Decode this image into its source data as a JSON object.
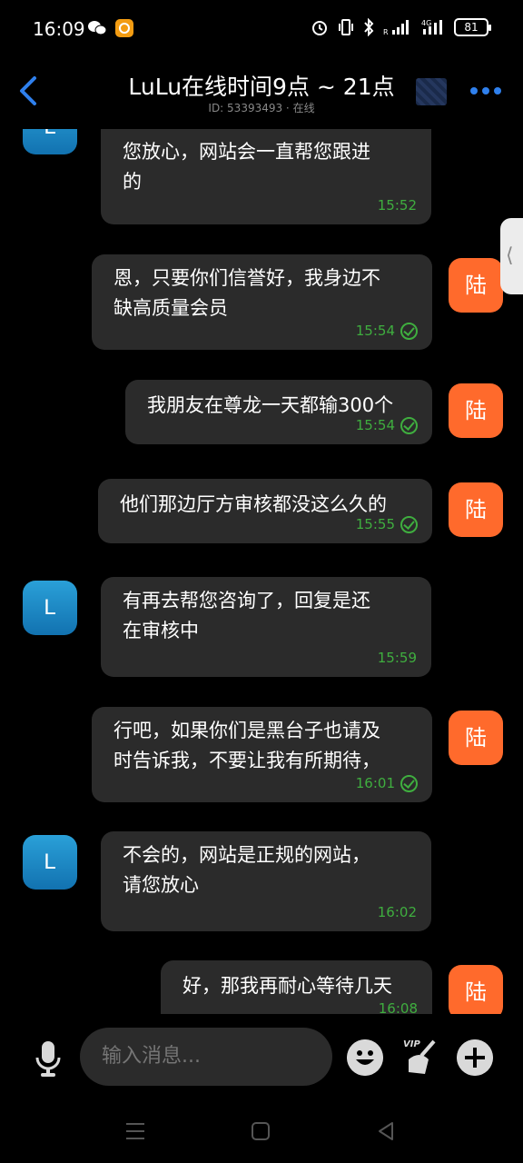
{
  "status_bar": {
    "time": "16:09",
    "battery": "81",
    "icons": [
      "wechat-icon",
      "app-badge-icon",
      "alarm-icon",
      "vibrate-icon",
      "bluetooth-icon",
      "signal-icon",
      "4g-signal-icon",
      "battery-icon"
    ]
  },
  "header": {
    "title": "LuLu在线时间9点 ~ 21点",
    "subtitle": "ID: 53393493 · 在线",
    "accent_color": "#2f80ed"
  },
  "messages": [
    {
      "sender": "L",
      "side": "left",
      "lines": [
        "您放心，网站会一直帮您跟进",
        "的"
      ],
      "time": "15:52",
      "read": false
    },
    {
      "sender": "陆",
      "side": "right",
      "lines": [
        "恩，只要你们信誉好，我身边不",
        "缺高质量会员"
      ],
      "time": "15:54",
      "read": true
    },
    {
      "sender": "陆",
      "side": "right",
      "lines": [
        "我朋友在尊龙一天都输300个"
      ],
      "time": "15:54",
      "read": true
    },
    {
      "sender": "陆",
      "side": "right",
      "lines": [
        "他们那边厅方审核都没这么久的"
      ],
      "time": "15:55",
      "read": true
    },
    {
      "sender": "L",
      "side": "left",
      "lines": [
        "有再去帮您咨询了，回复是还",
        "在审核中"
      ],
      "time": "15:59",
      "read": false
    },
    {
      "sender": "陆",
      "side": "right",
      "lines": [
        "行吧，如果你们是黑台子也请及",
        "时告诉我，不要让我有所期待，"
      ],
      "time": "16:01",
      "read": true
    },
    {
      "sender": "L",
      "side": "left",
      "lines": [
        "不会的，网站是正规的网站，",
        "请您放心"
      ],
      "time": "16:02",
      "read": false
    },
    {
      "sender": "陆",
      "side": "right",
      "lines": [
        "好，那我再耐心等待几天"
      ],
      "time": "16:08",
      "read": false
    }
  ],
  "input": {
    "placeholder": "输入消息..."
  },
  "colors": {
    "bubble": "#2b2b2b",
    "time_green": "#3fae3f",
    "my_avatar": "#ff6a2c",
    "agent_avatar": "#1a8ac8"
  }
}
